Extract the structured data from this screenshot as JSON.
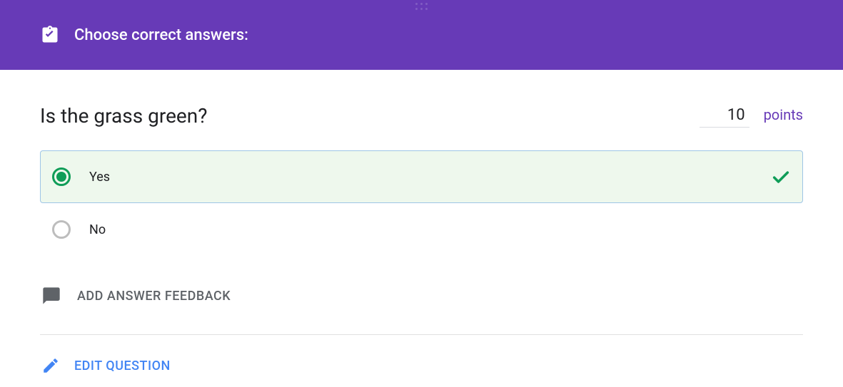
{
  "header": {
    "title": "Choose correct answers:"
  },
  "question": {
    "text": "Is the grass green?",
    "points_value": "10",
    "points_label": "points"
  },
  "options": [
    {
      "label": "Yes",
      "selected": true
    },
    {
      "label": "No",
      "selected": false
    }
  ],
  "actions": {
    "add_feedback_label": "ADD ANSWER FEEDBACK",
    "edit_question_label": "EDIT QUESTION"
  },
  "colors": {
    "primary": "#673AB7",
    "green": "#0f9d58",
    "blue": "#4285F4"
  }
}
